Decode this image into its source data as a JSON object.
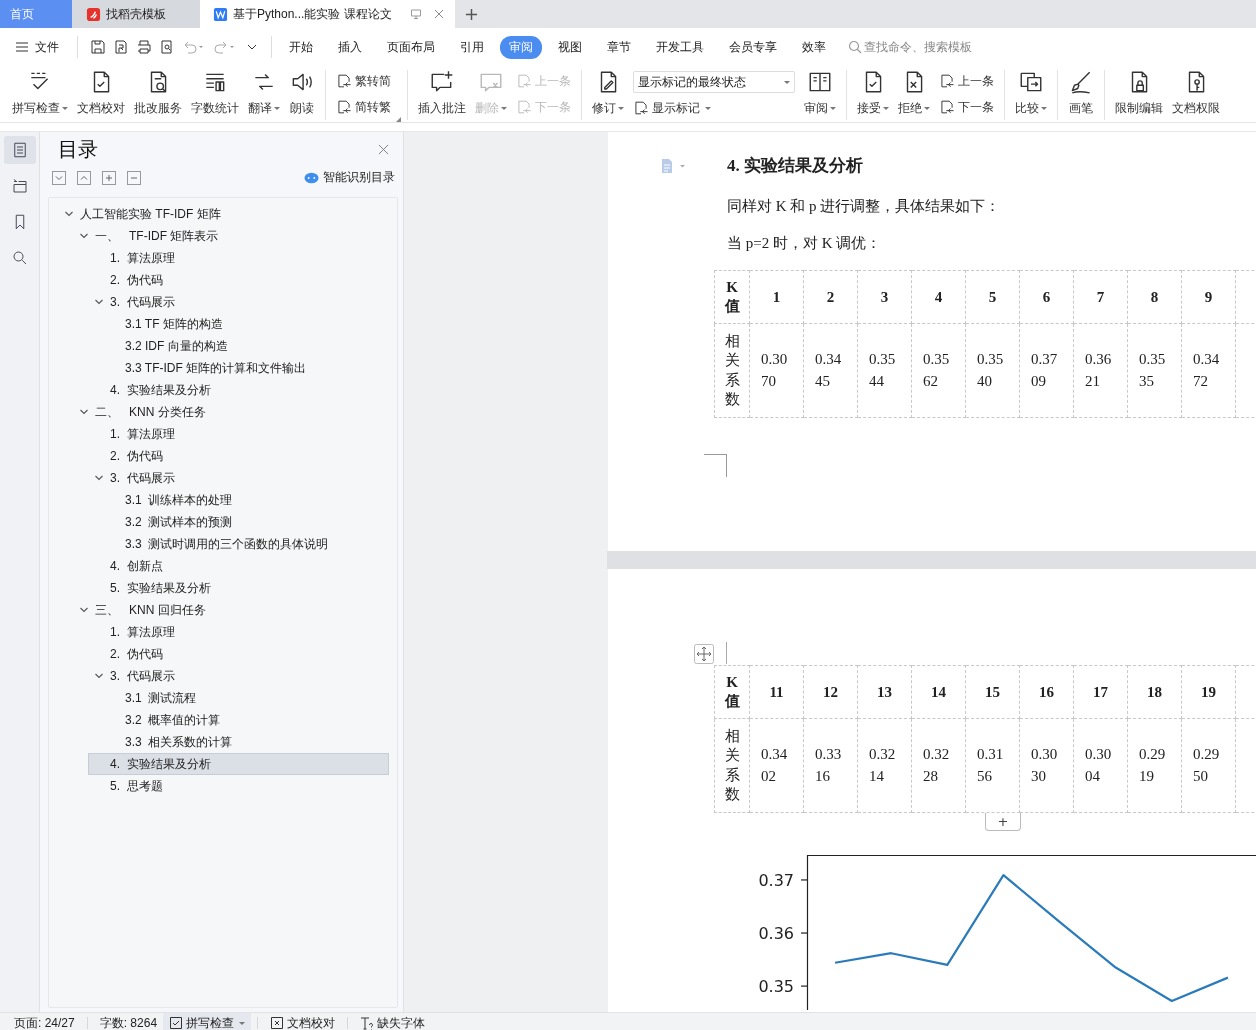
{
  "tab_bar": {
    "tabs": [
      {
        "label": "首页",
        "kind": "home",
        "selected": false
      },
      {
        "label": "找稻壳模板",
        "kind": "template",
        "selected": false
      },
      {
        "label": "基于Python...能实验 课程论文",
        "kind": "document",
        "selected": true
      }
    ]
  },
  "menu_bar": {
    "file": "文件",
    "tabs": [
      {
        "label": "开始",
        "selected": false
      },
      {
        "label": "插入",
        "selected": false
      },
      {
        "label": "页面布局",
        "selected": false
      },
      {
        "label": "引用",
        "selected": false
      },
      {
        "label": "审阅",
        "selected": true
      },
      {
        "label": "视图",
        "selected": false
      },
      {
        "label": "章节",
        "selected": false
      },
      {
        "label": "开发工具",
        "selected": false
      },
      {
        "label": "会员专享",
        "selected": false
      },
      {
        "label": "效率",
        "selected": false
      }
    ],
    "search": {
      "placeholder": "查找命令、搜索模板"
    }
  },
  "ribbon": {
    "groups": [
      {
        "columns": [
          [
            {
              "kind": "tool",
              "label": "拼写检查",
              "dropdown": true,
              "disabled": false
            }
          ],
          [
            {
              "kind": "tool",
              "label": "文档校对",
              "dropdown": false,
              "disabled": false
            }
          ],
          [
            {
              "kind": "tool",
              "label": "批改服务",
              "dropdown": false,
              "disabled": false
            }
          ],
          [
            {
              "kind": "tool",
              "label": "字数统计",
              "dropdown": false,
              "disabled": false
            }
          ],
          [
            {
              "kind": "tool",
              "label": "翻译",
              "dropdown": true,
              "disabled": false
            }
          ],
          [
            {
              "kind": "tool",
              "label": "朗读",
              "dropdown": false,
              "disabled": false
            }
          ]
        ]
      },
      {
        "columns": [
          [
            {
              "kind": "tool",
              "label": "繁转简",
              "dropdown": false,
              "disabled": false
            },
            {
              "kind": "tool",
              "label": "简转繁",
              "dropdown": false,
              "disabled": false
            }
          ]
        ]
      },
      {
        "columns": [
          [
            {
              "kind": "tool",
              "label": "插入批注",
              "dropdown": false,
              "disabled": false
            }
          ],
          [
            {
              "kind": "tool",
              "label": "删除",
              "dropdown": true,
              "disabled": true
            }
          ],
          [
            {
              "kind": "tool",
              "label": "上一条",
              "dropdown": false,
              "disabled": true
            },
            {
              "kind": "tool",
              "label": "下一条",
              "dropdown": false,
              "disabled": true
            }
          ]
        ]
      },
      {
        "columns": [
          [
            {
              "kind": "tool",
              "label": "修订",
              "dropdown": true,
              "disabled": false
            }
          ],
          [
            {
              "kind": "select",
              "value": "显示标记的最终状态"
            },
            {
              "kind": "tool",
              "label": "显示标记",
              "dropdown": true,
              "disabled": false
            }
          ],
          [
            {
              "kind": "tool",
              "label": "审阅",
              "dropdown": true,
              "disabled": false
            }
          ]
        ]
      },
      {
        "columns": [
          [
            {
              "kind": "tool",
              "label": "接受",
              "dropdown": true,
              "disabled": false
            }
          ],
          [
            {
              "kind": "tool",
              "label": "拒绝",
              "dropdown": true,
              "disabled": false
            }
          ],
          [
            {
              "kind": "tool",
              "label": "上一条",
              "dropdown": false,
              "disabled": false
            },
            {
              "kind": "tool",
              "label": "下一条",
              "dropdown": false,
              "disabled": false
            }
          ]
        ]
      },
      {
        "columns": [
          [
            {
              "kind": "tool",
              "label": "比较",
              "dropdown": true,
              "disabled": false
            }
          ]
        ]
      },
      {
        "columns": [
          [
            {
              "kind": "tool",
              "label": "画笔",
              "dropdown": false,
              "disabled": false
            }
          ]
        ]
      },
      {
        "columns": [
          [
            {
              "kind": "tool",
              "label": "限制编辑",
              "dropdown": false,
              "disabled": false
            }
          ],
          [
            {
              "kind": "tool",
              "label": "文档权限",
              "dropdown": false,
              "disabled": false
            }
          ]
        ]
      }
    ]
  },
  "side_strip": [
    {
      "selected": true
    },
    {
      "selected": false
    },
    {
      "selected": false
    },
    {
      "selected": false
    }
  ],
  "toc": {
    "title": "目录",
    "smart_button": "智能识别目录",
    "items": [
      {
        "label": "人工智能实验 TF-IDF 矩阵",
        "selected": false,
        "expanded": true,
        "children": [
          {
            "label": "一、   TF-IDF 矩阵表示",
            "selected": false,
            "expanded": true,
            "children": [
              {
                "label": "1.  算法原理",
                "selected": false
              },
              {
                "label": "2.  伪代码",
                "selected": false
              },
              {
                "label": "3.  代码展示",
                "selected": false,
                "expanded": true,
                "children": [
                  {
                    "label": "3.1 TF 矩阵的构造",
                    "selected": false
                  },
                  {
                    "label": "3.2 IDF 向量的构造",
                    "selected": false
                  },
                  {
                    "label": "3.3 TF-IDF 矩阵的计算和文件输出",
                    "selected": false
                  }
                ]
              },
              {
                "label": "4.  实验结果及分析",
                "selected": false
              }
            ]
          },
          {
            "label": "二、   KNN 分类任务",
            "selected": false,
            "expanded": true,
            "children": [
              {
                "label": "1.  算法原理",
                "selected": false
              },
              {
                "label": "2.  伪代码",
                "selected": false
              },
              {
                "label": "3.  代码展示",
                "selected": false,
                "expanded": true,
                "children": [
                  {
                    "label": "3.1  训练样本的处理",
                    "selected": false
                  },
                  {
                    "label": "3.2  测试样本的预测",
                    "selected": false
                  },
                  {
                    "label": "3.3  测试时调用的三个函数的具体说明",
                    "selected": false
                  }
                ]
              },
              {
                "label": "4.  创新点",
                "selected": false
              },
              {
                "label": "5.  实验结果及分析",
                "selected": false
              }
            ]
          },
          {
            "label": "三、   KNN 回归任务",
            "selected": false,
            "expanded": true,
            "children": [
              {
                "label": "1.  算法原理",
                "selected": false
              },
              {
                "label": "2.  伪代码",
                "selected": false
              },
              {
                "label": "3.  代码展示",
                "selected": false,
                "expanded": true,
                "children": [
                  {
                    "label": "3.1  测试流程",
                    "selected": false
                  },
                  {
                    "label": "3.2  概率值的计算",
                    "selected": false
                  },
                  {
                    "label": "3.3  相关系数的计算",
                    "selected": false
                  }
                ]
              },
              {
                "label": "4.  实验结果及分析",
                "selected": true
              },
              {
                "label": "5.  思考题",
                "selected": false
              }
            ]
          }
        ]
      }
    ]
  },
  "document": {
    "heading": "4.  实验结果及分析",
    "paragraphs": [
      "同样对 K 和 p 进行调整，具体结果如下：",
      "当 p=2 时，对 K 调优："
    ],
    "tables": [
      {
        "header_label": "K值",
        "row_label": "相关系数",
        "columns": [
          {
            "k": "1",
            "value": "0.3070"
          },
          {
            "k": "2",
            "value": "0.3445"
          },
          {
            "k": "3",
            "value": "0.3544"
          },
          {
            "k": "4",
            "value": "0.3562"
          },
          {
            "k": "5",
            "value": "0.3540"
          },
          {
            "k": "6",
            "value": "0.3709"
          },
          {
            "k": "7",
            "value": "0.3621"
          },
          {
            "k": "8",
            "value": "0.3535"
          },
          {
            "k": "9",
            "value": "0.3472"
          }
        ]
      },
      {
        "header_label": "K值",
        "row_label": "相关系数",
        "columns": [
          {
            "k": "11",
            "value": "0.3402"
          },
          {
            "k": "12",
            "value": "0.3316"
          },
          {
            "k": "13",
            "value": "0.3214"
          },
          {
            "k": "14",
            "value": "0.3228"
          },
          {
            "k": "15",
            "value": "0.3156"
          },
          {
            "k": "16",
            "value": "0.3030"
          },
          {
            "k": "17",
            "value": "0.3004"
          },
          {
            "k": "18",
            "value": "0.2919"
          },
          {
            "k": "19",
            "value": "0.2950"
          }
        ]
      }
    ],
    "add_row_button": "+",
    "chart_data": {
      "type": "line",
      "categories": [
        null,
        null,
        null,
        null,
        null,
        null,
        null,
        null
      ],
      "series": [
        {
          "color": "#2b7bba",
          "values": [
            0.3544,
            0.3562,
            0.354,
            0.3709,
            0.3621,
            0.3535,
            0.3472,
            0.3516
          ]
        }
      ],
      "ylim": [
        0.3455,
        0.3747
      ],
      "yticks": [
        {
          "value": 0.37,
          "label": "0.37"
        },
        {
          "value": 0.36,
          "label": "0.36"
        },
        {
          "value": 0.35,
          "label": "0.35"
        }
      ]
    }
  },
  "status_bar": {
    "page": "页面: 24/27",
    "words": "字数: 8264",
    "spell_check": "拼写检查",
    "proofread": "文档校对",
    "missing_fonts": "缺失字体"
  }
}
